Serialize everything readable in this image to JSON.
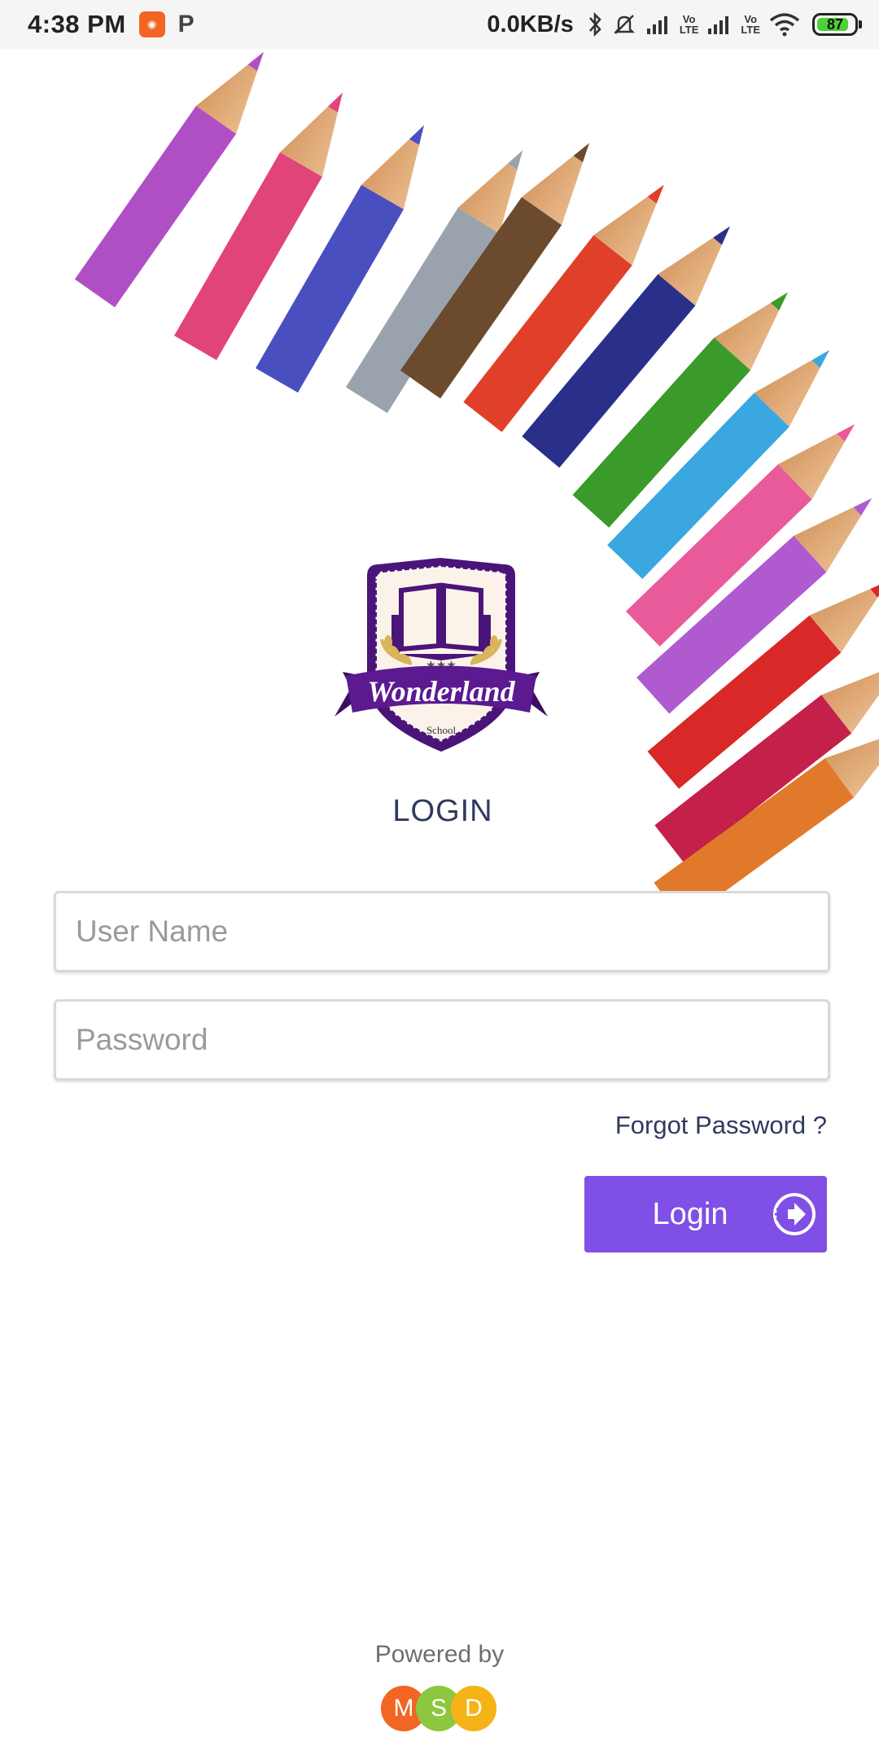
{
  "status_bar": {
    "time": "4:38 PM",
    "notification_icon": "app-notification-icon",
    "p_icon_label": "P",
    "network_speed": "0.0KB/s",
    "volte_1": "Vo\nLTE",
    "volte_2": "Vo\nLTE",
    "battery_level": "87",
    "battery_fraction": 0.87
  },
  "logo": {
    "name": "Wonderland",
    "sub": "School"
  },
  "login": {
    "title": "LOGIN",
    "username_placeholder": "User Name",
    "password_placeholder": "Password",
    "forgot_label": "Forgot Password ?",
    "button_label": "Login"
  },
  "footer": {
    "powered_label": "Powered by",
    "brand_letters": [
      "M",
      "S",
      "D"
    ],
    "brand_colors": [
      "#f26522",
      "#8dc63f",
      "#f5b317"
    ]
  },
  "colors": {
    "accent": "#7f4fe6",
    "title": "#2f3a5f",
    "logo_purple": "#4b1478"
  }
}
